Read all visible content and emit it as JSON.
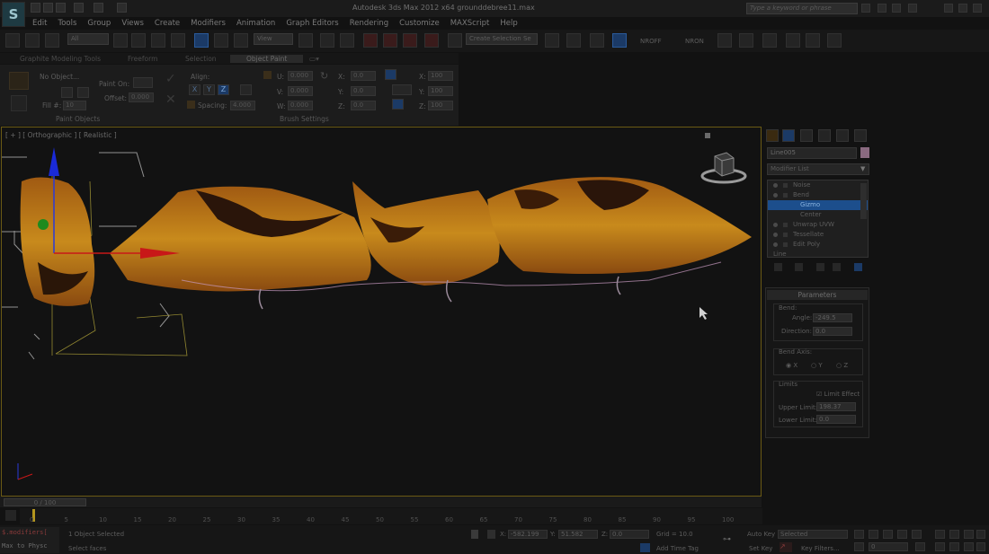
{
  "window": {
    "title": "Autodesk 3ds Max  2012 x64       grounddebree11.max",
    "search_placeholder": "Type a keyword or phrase"
  },
  "menu": [
    "Edit",
    "Tools",
    "Group",
    "Views",
    "Create",
    "Modifiers",
    "Animation",
    "Graph Editors",
    "Rendering",
    "Customize",
    "MAXScript",
    "Help"
  ],
  "toolbar": {
    "selection_filter": "All",
    "ref_coord": "View",
    "named_selection": "Create Selection Se",
    "nroff": "NROFF",
    "nron": "NRON"
  },
  "ribbon": {
    "tabs": [
      "Graphite Modeling Tools",
      "Freeform",
      "Selection",
      "Object Paint"
    ],
    "active_tab": "Object Paint",
    "paint_objects": {
      "no_object": "No Object...",
      "paint_on": "Paint On:",
      "offset_label": "Offset:",
      "offset_value": "0.000",
      "fill_label": "Fill #:",
      "fill_value": "10",
      "footer": "Paint Objects"
    },
    "brush_settings": {
      "align": "Align:",
      "axes": [
        "X",
        "Y",
        "Z"
      ],
      "spacing_label": "Spacing:",
      "spacing_value": "4.000",
      "u_label": "U:",
      "u_value": "0.000",
      "v_label": "V:",
      "v_value": "0.000",
      "w_label": "W:",
      "w_value": "0.000",
      "x_label": "X:",
      "x_value": "0.0",
      "y_label": "Y:",
      "y_value": "0.0",
      "z_label": "Z:",
      "z_value": "0.0",
      "sx_label": "X:",
      "sx_value": "100",
      "sy_label": "Y:",
      "sy_value": "100",
      "sz_label": "Z:",
      "sz_value": "100",
      "footer": "Brush Settings"
    }
  },
  "viewport": {
    "label": "[ + ] [ Orthographic ] [ Realistic ]"
  },
  "command_panel": {
    "object_name": "Line005",
    "modifier_list": "Modifier List",
    "stack": [
      {
        "label": "Noise",
        "selected": false
      },
      {
        "label": "Bend",
        "selected": false
      },
      {
        "label": "Gizmo",
        "selected": true
      },
      {
        "label": "Center",
        "selected": false
      },
      {
        "label": "Unwrap UVW",
        "selected": false
      },
      {
        "label": "Tessellate",
        "selected": false
      },
      {
        "label": "Edit Poly",
        "selected": false
      },
      {
        "label": "Line",
        "selected": false
      }
    ],
    "parameters": {
      "title": "Parameters",
      "bend_label": "Bend:",
      "angle_label": "Angle:",
      "angle_value": "-249.5",
      "direction_label": "Direction:",
      "direction_value": "0.0",
      "bend_axis_label": "Bend Axis:",
      "axes": [
        "X",
        "Y",
        "Z"
      ],
      "limits_label": "Limits",
      "limit_effect": "Limit Effect",
      "upper_label": "Upper Limit:",
      "upper_value": "198.37",
      "lower_label": "Lower Limit:",
      "lower_value": "0.0"
    }
  },
  "timeline": {
    "slider": "0 / 100",
    "ticks": [
      "0",
      "5",
      "10",
      "15",
      "20",
      "25",
      "30",
      "35",
      "40",
      "45",
      "50",
      "55",
      "60",
      "65",
      "70",
      "75",
      "80",
      "85",
      "90",
      "95",
      "100"
    ]
  },
  "status": {
    "maxscript_line1": "$.modifiers[",
    "maxscript_line2": "Max to Physc",
    "selected_count": "1 Object Selected",
    "prompt": "Select faces",
    "x_label": "X:",
    "x_value": "-582.199",
    "y_label": "Y:",
    "y_value": "51.582",
    "z_label": "Z:",
    "z_value": "0.0",
    "grid": "Grid = 10.0",
    "add_time_tag": "Add Time Tag",
    "auto_key": "Auto Key",
    "auto_key_value": "Selected",
    "set_key": "Set Key",
    "key_filters": "Key Filters...",
    "frame_value": "0"
  }
}
